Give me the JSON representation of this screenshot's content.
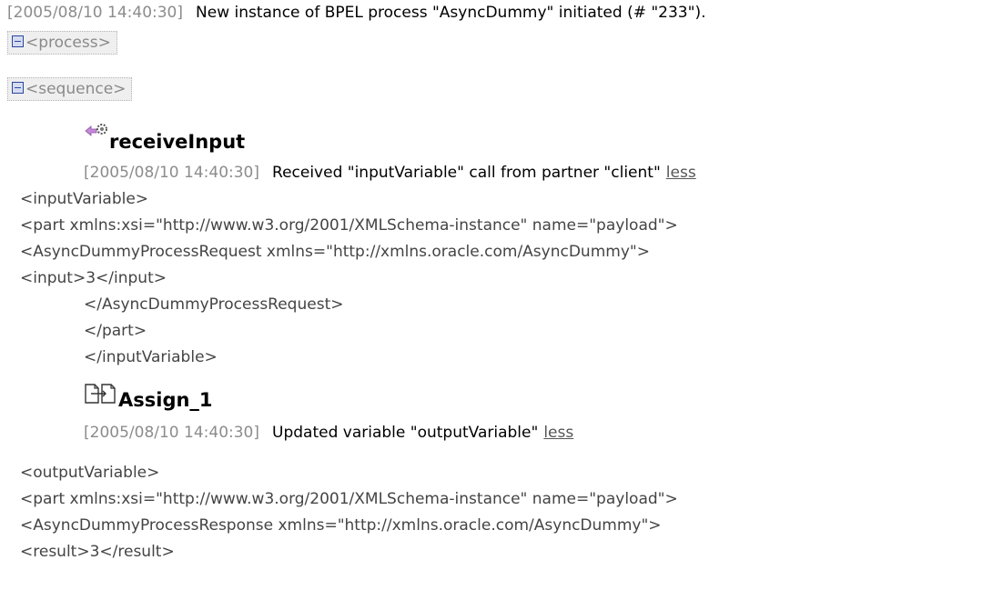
{
  "header": {
    "timestamp": "[2005/08/10 14:40:30]",
    "message": "New instance of BPEL process \"AsyncDummy\" initiated (# \"233\")."
  },
  "tree": {
    "process_tag": "<process>",
    "sequence_tag": "<sequence>"
  },
  "activities": [
    {
      "name": "receiveInput",
      "icon": "receive-gear-icon",
      "timestamp": "[2005/08/10 14:40:30]",
      "message": "Received \"inputVariable\" call from partner \"client\"",
      "link": "less",
      "xml": [
        "<inputVariable>",
        "<part xmlns:xsi=\"http://www.w3.org/2001/XMLSchema-instance\" name=\"payload\">",
        "<AsyncDummyProcessRequest xmlns=\"http://xmlns.oracle.com/AsyncDummy\">",
        "<input>3</input>",
        "</AsyncDummyProcessRequest>",
        "</part>",
        "</inputVariable>"
      ]
    },
    {
      "name": "Assign_1",
      "icon": "assign-icon",
      "timestamp": "[2005/08/10 14:40:30]",
      "message": "Updated variable \"outputVariable\"",
      "link": "less",
      "xml": [
        "<outputVariable>",
        "<part xmlns:xsi=\"http://www.w3.org/2001/XMLSchema-instance\" name=\"payload\">",
        "<AsyncDummyProcessResponse xmlns=\"http://xmlns.oracle.com/AsyncDummy\">",
        "<result>3</result>"
      ]
    }
  ],
  "colors": {
    "timestamp": "#8c8c8c",
    "tag_bg": "#efefef",
    "toggle_border": "#2b47a1",
    "receive_arrow": "#c58ad8"
  }
}
